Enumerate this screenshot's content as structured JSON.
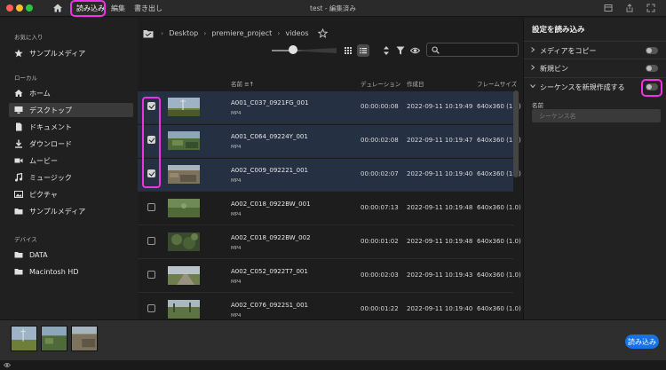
{
  "window": {
    "title": "test - 編集済み",
    "tabs": [
      {
        "label": "読み込み",
        "active": true
      },
      {
        "label": "編集",
        "active": false
      },
      {
        "label": "書き出し",
        "active": false
      }
    ]
  },
  "sidebar": {
    "favorites_header": "お気に入り",
    "favorites": [
      {
        "label": "サンプルメディア",
        "icon": "star-icon"
      }
    ],
    "locations_header": "ローカル",
    "locations": [
      {
        "label": "ホーム",
        "icon": "home-icon"
      },
      {
        "label": "デスクトップ",
        "icon": "desktop-icon",
        "selected": true
      },
      {
        "label": "ドキュメント",
        "icon": "document-icon"
      },
      {
        "label": "ダウンロード",
        "icon": "download-icon"
      },
      {
        "label": "ムービー",
        "icon": "movie-icon"
      },
      {
        "label": "ミュージック",
        "icon": "music-icon"
      },
      {
        "label": "ピクチャ",
        "icon": "picture-icon"
      },
      {
        "label": "サンプルメディア",
        "icon": "folder-icon"
      }
    ],
    "devices_header": "デバイス",
    "devices": [
      {
        "label": "DATA",
        "icon": "drive-icon"
      },
      {
        "label": "Macintosh HD",
        "icon": "drive-icon"
      }
    ]
  },
  "breadcrumb": [
    "Desktop",
    "premiere_project",
    "videos"
  ],
  "search": {
    "placeholder": "",
    "value": ""
  },
  "table": {
    "columns": {
      "name": "名前",
      "duration": "デュレーション",
      "created": "作成日",
      "framesize": "フレームサイズ"
    },
    "rows": [
      {
        "name": "A001_C037_0921FG_001",
        "type": "MP4",
        "duration": "00:00:00:08",
        "created": "2022-09-11 10:19:49",
        "framesize": "640x360 (1.0)",
        "checked": true
      },
      {
        "name": "A001_C064_09224Y_001",
        "type": "MP4",
        "duration": "00:00:02:08",
        "created": "2022-09-11 10:19:47",
        "framesize": "640x360 (1.0)",
        "checked": true
      },
      {
        "name": "A002_C009_092221_001",
        "type": "MP4",
        "duration": "00:00:02:07",
        "created": "2022-09-11 10:19:40",
        "framesize": "640x360 (1.0)",
        "checked": true
      },
      {
        "name": "A002_C018_0922BW_001",
        "type": "MP4",
        "duration": "00:00:07:13",
        "created": "2022-09-11 10:19:48",
        "framesize": "640x360 (1.0)",
        "checked": false
      },
      {
        "name": "A002_C018_0922BW_002",
        "type": "MP4",
        "duration": "00:00:01:02",
        "created": "2022-09-11 10:19:48",
        "framesize": "640x360 (1.0)",
        "checked": false
      },
      {
        "name": "A002_C052_0922T7_001",
        "type": "MP4",
        "duration": "00:00:02:03",
        "created": "2022-09-11 10:19:43",
        "framesize": "640x360 (1.0)",
        "checked": false
      },
      {
        "name": "A002_C076_0922S1_001",
        "type": "MP4",
        "duration": "00:00:01:22",
        "created": "2022-09-11 10:19:40",
        "framesize": "640x360 (1.0)",
        "checked": false
      }
    ]
  },
  "right_panel": {
    "title": "設定を読み込み",
    "options": [
      {
        "label": "メディアをコピー",
        "on": false
      },
      {
        "label": "新規ビン",
        "on": false
      },
      {
        "label": "シーケンスを新規作成する",
        "on": false
      }
    ],
    "name_label": "名前",
    "name_placeholder": "シーケンス名"
  },
  "bottom": {
    "import_button": "読み込み"
  },
  "colors": {
    "accent": "#1473e6",
    "highlight": "#ee33e5",
    "selected_row": "#253043"
  }
}
